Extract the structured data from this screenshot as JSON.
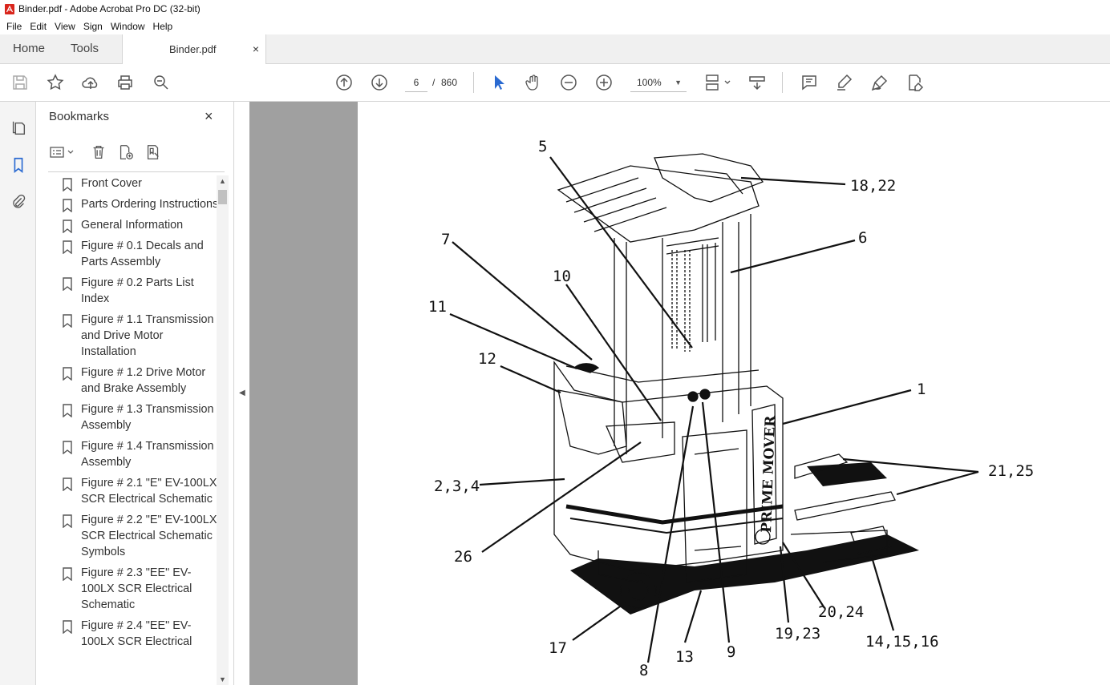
{
  "window": {
    "title": "Binder.pdf - Adobe Acrobat Pro DC (32-bit)"
  },
  "menu": [
    "File",
    "Edit",
    "View",
    "Sign",
    "Window",
    "Help"
  ],
  "tabs": {
    "home": "Home",
    "tools": "Tools",
    "document": "Binder.pdf",
    "close": "×"
  },
  "toolbar": {
    "current_page": "6",
    "page_separator": "/",
    "page_count": "860",
    "zoom": "100%",
    "icons": [
      "save-icon",
      "star-icon",
      "upload-icon",
      "print-icon",
      "search-zoom-icon",
      "page-up-icon",
      "page-down-icon",
      "select-arrow-icon",
      "hand-icon",
      "zoom-out-icon",
      "zoom-in-icon",
      "fit-page-icon",
      "scroll-mode-icon",
      "comment-icon",
      "highlight-icon",
      "sign-icon",
      "edit-pdf-icon"
    ]
  },
  "bookmarks": {
    "title": "Bookmarks",
    "close": "×",
    "items": [
      {
        "label": "Front Cover"
      },
      {
        "label": "Parts Ordering Instructions"
      },
      {
        "label": "General Information"
      },
      {
        "label": "Figure # 0.1 Decals and Parts Assembly"
      },
      {
        "label": "Figure # 0.2 Parts List Index"
      },
      {
        "label": "Figure # 1.1 Transmission and Drive Motor Installation"
      },
      {
        "label": "Figure # 1.2 Drive Motor and Brake Assembly"
      },
      {
        "label": "Figure # 1.3 Transmission Assembly"
      },
      {
        "label": "Figure # 1.4 Transmission Assembly"
      },
      {
        "label": "Figure # 2.1 \"E\" EV-100LX SCR Electrical Schematic"
      },
      {
        "label": "Figure # 2.2 \"E\" EV-100LX SCR Electrical Schematic Symbols"
      },
      {
        "label": "Figure # 2.3 \"EE\" EV-100LX SCR Electrical Schematic"
      },
      {
        "label": "Figure # 2.4 \"EE\" EV-100LX SCR Electrical"
      }
    ]
  },
  "drawing": {
    "brand_text": "PRIME MOVER",
    "callouts": [
      "5",
      "18,22",
      "7",
      "6",
      "10",
      "11",
      "12",
      "1",
      "21,25",
      "2,3,4",
      "26",
      "17",
      "8",
      "13",
      "9",
      "19,23",
      "20,24",
      "14,15,16"
    ]
  }
}
